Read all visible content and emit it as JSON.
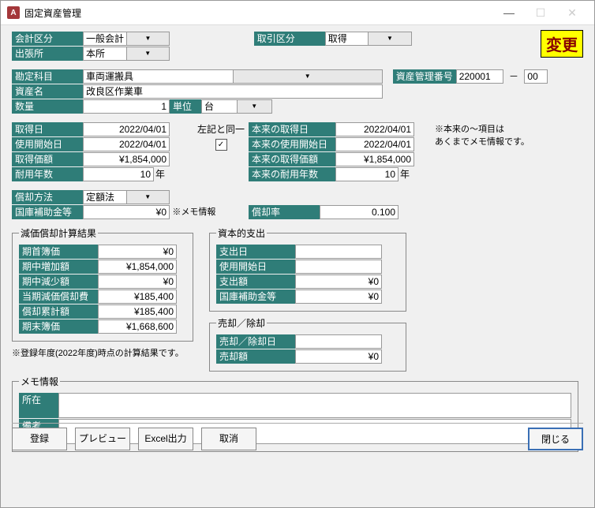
{
  "window_title": "固定資産管理",
  "badge": "変更",
  "top": {
    "kaikei_lbl": "会計区分",
    "kaikei_val": "一般会計",
    "torihiki_lbl": "取引区分",
    "torihiki_val": "取得",
    "shucchojo_lbl": "出張所",
    "shucchojo_val": "本所"
  },
  "asset": {
    "kamoku_lbl": "勘定科目",
    "kamoku_val": "車両運搬具",
    "name_lbl": "資産名",
    "name_val": "改良区作業車",
    "qty_lbl": "数量",
    "qty_val": "1",
    "unit_lbl": "単位",
    "unit_val": "台",
    "mgmt_no_lbl": "資産管理番号",
    "mgmt_no_val": "220001",
    "mgmt_no_sep": "－",
    "mgmt_no_suffix": "00"
  },
  "acq": {
    "date_lbl": "取得日",
    "date_val": "2022/04/01",
    "start_lbl": "使用開始日",
    "start_val": "2022/04/01",
    "price_lbl": "取得価額",
    "price_val": "¥1,854,000",
    "life_lbl": "耐用年数",
    "life_val": "10",
    "life_unit": "年",
    "same_lbl": "左記と同一",
    "same_checked": "✓"
  },
  "orig": {
    "date_lbl": "本来の取得日",
    "date_val": "2022/04/01",
    "start_lbl": "本来の使用開始日",
    "start_val": "2022/04/01",
    "price_lbl": "本来の取得価額",
    "price_val": "¥1,854,000",
    "life_lbl": "本来の耐用年数",
    "life_val": "10",
    "life_unit": "年",
    "note1": "※本来の～項目は",
    "note2": "あくまでメモ情報です。"
  },
  "dep": {
    "method_lbl": "償却方法",
    "method_val": "定額法",
    "subsidy_lbl": "国庫補助金等",
    "subsidy_val": "¥0",
    "subsidy_note": "※メモ情報",
    "rate_lbl": "償却率",
    "rate_val": "0.100"
  },
  "calc": {
    "legend": "減価償却計算結果",
    "opening_lbl": "期首簿価",
    "opening_val": "¥0",
    "increase_lbl": "期中増加額",
    "increase_val": "¥1,854,000",
    "decrease_lbl": "期中減少額",
    "decrease_val": "¥0",
    "dep_lbl": "当期減価償却費",
    "dep_val": "¥185,400",
    "accum_lbl": "償却累計額",
    "accum_val": "¥185,400",
    "closing_lbl": "期末簿価",
    "closing_val": "¥1,668,600",
    "note": "※登録年度(2022年度)時点の計算結果です。"
  },
  "capex": {
    "legend": "資本的支出",
    "date_lbl": "支出日",
    "date_val": "",
    "start_lbl": "使用開始日",
    "start_val": "",
    "amount_lbl": "支出額",
    "amount_val": "¥0",
    "subsidy_lbl": "国庫補助金等",
    "subsidy_val": "¥0"
  },
  "disposal": {
    "legend": "売却／除却",
    "date_lbl": "売却／除却日",
    "date_val": "",
    "amount_lbl": "売却額",
    "amount_val": "¥0"
  },
  "memo": {
    "legend": "メモ情報",
    "loc_lbl": "所在",
    "loc_val": "",
    "remark_lbl": "備考",
    "remark_val": ""
  },
  "buttons": {
    "register": "登録",
    "preview": "プレビュー",
    "excel": "Excel出力",
    "cancel": "取消",
    "close": "閉じる"
  }
}
